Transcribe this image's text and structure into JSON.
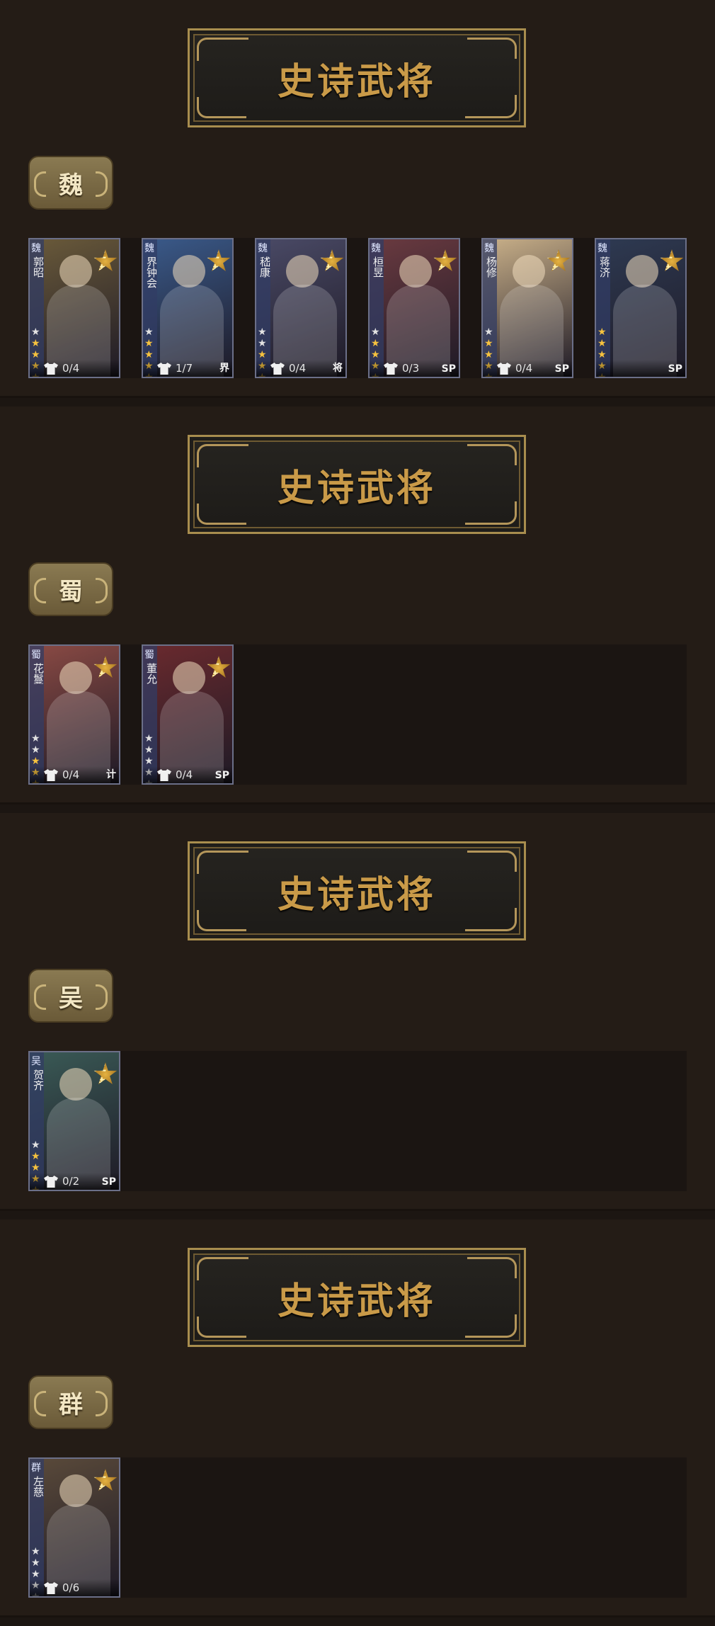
{
  "sections": [
    {
      "banner": "史诗武将",
      "kingdom": "魏",
      "cards": [
        {
          "kingdom": "魏",
          "name": "郭昭",
          "count": "0/4",
          "tag": "",
          "stars": [
            false,
            true,
            true,
            true,
            true
          ],
          "tone": "#6a5a3a"
        },
        {
          "kingdom": "魏",
          "name": "界钟会",
          "count": "1/7",
          "tag": "界",
          "stars": [
            false,
            true,
            true,
            true,
            true
          ],
          "tone": "#3a5a8a"
        },
        {
          "kingdom": "魏",
          "name": "嵇康",
          "count": "0/4",
          "tag": "将",
          "stars": [
            false,
            false,
            true,
            true,
            true
          ],
          "tone": "#4a4a66"
        },
        {
          "kingdom": "魏",
          "name": "桓昱",
          "count": "0/3",
          "tag": "SP",
          "stars": [
            false,
            true,
            true,
            true,
            true
          ],
          "tone": "#6a3a40"
        },
        {
          "kingdom": "魏",
          "name": "杨修",
          "count": "0/4",
          "tag": "SP",
          "stars": [
            false,
            true,
            true,
            true,
            true
          ],
          "tone": "#c9b089"
        },
        {
          "kingdom": "魏",
          "name": "蒋济",
          "count": "",
          "tag": "SP",
          "stars": [
            true,
            true,
            true,
            true,
            true
          ],
          "tone": "#2e3a52"
        }
      ]
    },
    {
      "banner": "史诗武将",
      "kingdom": "蜀",
      "cards": [
        {
          "kingdom": "蜀",
          "name": "花鬘",
          "count": "0/4",
          "tag": "计",
          "stars": [
            false,
            false,
            true,
            true,
            true
          ],
          "tone": "#8a4a44"
        },
        {
          "kingdom": "蜀",
          "name": "董允",
          "count": "0/4",
          "tag": "SP",
          "stars": [
            false,
            false,
            false,
            false,
            false
          ],
          "tone": "#6a2a2e"
        }
      ]
    },
    {
      "banner": "史诗武将",
      "kingdom": "吴",
      "cards": [
        {
          "kingdom": "吴",
          "name": "贺齐",
          "count": "0/2",
          "tag": "SP",
          "stars": [
            false,
            true,
            true,
            true,
            true
          ],
          "tone": "#3a5a56"
        }
      ]
    },
    {
      "banner": "史诗武将",
      "kingdom": "群",
      "cards": [
        {
          "kingdom": "群",
          "name": "左慈",
          "count": "0/6",
          "tag": "",
          "stars": [
            false,
            false,
            false,
            false,
            false
          ],
          "tone": "#5a4a3a"
        }
      ]
    }
  ],
  "epic_badge": "史诗",
  "colors": {
    "star_on": "#f6c23e",
    "star_off": "#e2e2e2",
    "banner_text": "#c99a48"
  },
  "icons": {
    "costume": "shirt-icon",
    "epic": "epic-star-badge-icon"
  }
}
